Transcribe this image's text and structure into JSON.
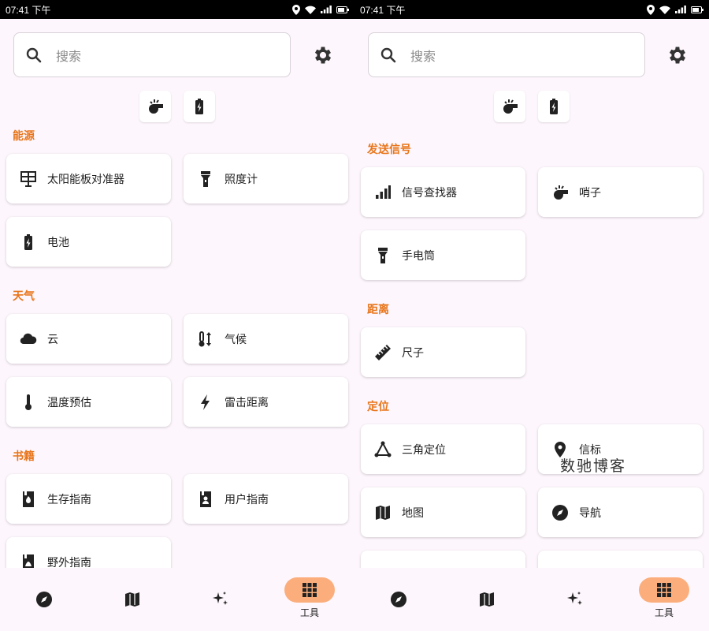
{
  "status": {
    "time": "07:41 下午"
  },
  "search": {
    "placeholder": "搜索"
  },
  "left": {
    "sections": [
      {
        "title": "能源",
        "items": [
          {
            "label": "太阳能板对准器",
            "icon": "solar-panel-icon"
          },
          {
            "label": "照度计",
            "icon": "flashlight-icon"
          },
          {
            "label": "电池",
            "icon": "battery-icon"
          }
        ]
      },
      {
        "title": "天气",
        "items": [
          {
            "label": "云",
            "icon": "cloud-icon"
          },
          {
            "label": "气候",
            "icon": "thermometer-arrows-icon"
          },
          {
            "label": "温度预估",
            "icon": "thermometer-icon"
          },
          {
            "label": "雷击距离",
            "icon": "lightning-icon"
          }
        ]
      },
      {
        "title": "书籍",
        "items": [
          {
            "label": "生存指南",
            "icon": "survival-book-icon"
          },
          {
            "label": "用户指南",
            "icon": "user-guide-icon"
          },
          {
            "label": "野外指南",
            "icon": "field-guide-icon"
          }
        ]
      }
    ]
  },
  "right": {
    "sections": [
      {
        "title": "发送信号",
        "items": [
          {
            "label": "信号查找器",
            "icon": "signal-bars-icon"
          },
          {
            "label": "哨子",
            "icon": "whistle-icon"
          },
          {
            "label": "手电筒",
            "icon": "flashlight-icon"
          }
        ]
      },
      {
        "title": "距离",
        "items": [
          {
            "label": "尺子",
            "icon": "ruler-icon"
          }
        ]
      },
      {
        "title": "定位",
        "items": [
          {
            "label": "三角定位",
            "icon": "triangulate-icon"
          },
          {
            "label": "信标",
            "icon": "map-pin-icon"
          },
          {
            "label": "地图",
            "icon": "map-icon"
          },
          {
            "label": "导航",
            "icon": "compass-icon"
          }
        ]
      }
    ]
  },
  "nav": {
    "active_label": "工具",
    "items": [
      "compass-icon",
      "map-icon",
      "sparkle-icon",
      "grid-icon"
    ]
  },
  "watermark": "数驰博客",
  "colors": {
    "accent": "#e8751a",
    "nav_active": "#fbae7c",
    "background": "#fdf6fc"
  }
}
